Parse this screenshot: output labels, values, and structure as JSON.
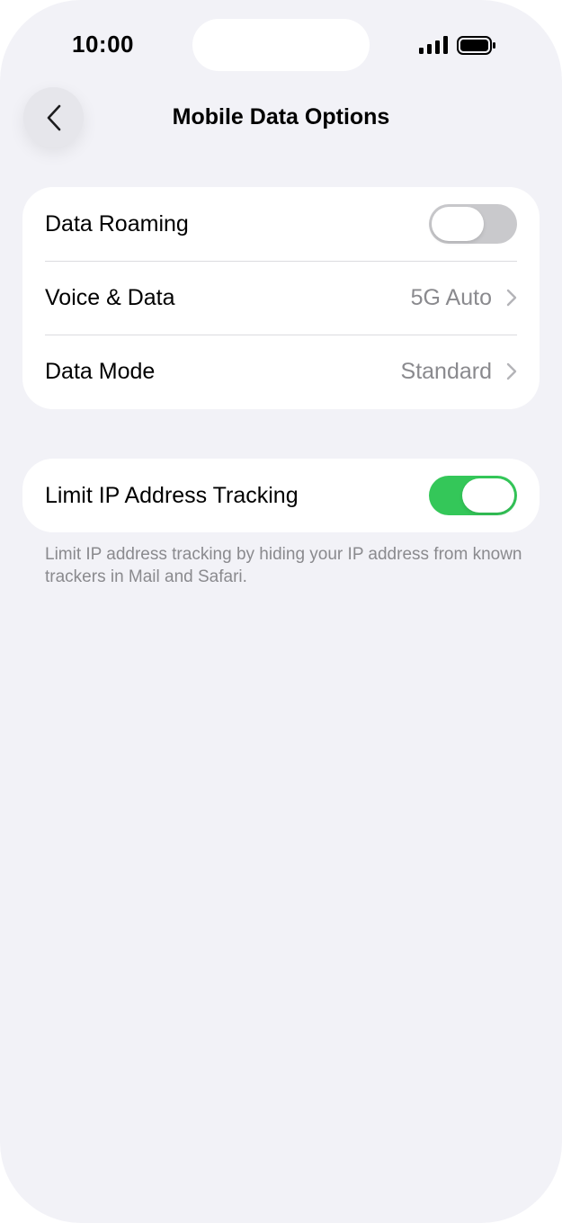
{
  "status_bar": {
    "time": "10:00",
    "icons": [
      "signal-icon",
      "battery-icon"
    ]
  },
  "nav": {
    "back_icon": "chevron-left-icon",
    "title": "Mobile Data Options"
  },
  "colors": {
    "background": "#f2f2f7",
    "toggle_on": "#34c759",
    "toggle_off": "#c9c9cc",
    "secondary_text": "#8a8a8e"
  },
  "group1": {
    "data_roaming": {
      "label": "Data Roaming",
      "toggle": "off"
    },
    "voice_data": {
      "label": "Voice & Data",
      "value": "5G Auto"
    },
    "data_mode": {
      "label": "Data Mode",
      "value": "Standard"
    }
  },
  "group2": {
    "limit_ip": {
      "label": "Limit IP Address Tracking",
      "toggle": "on"
    },
    "footer": "Limit IP address tracking by hiding your IP address from known trackers in Mail and Safari."
  }
}
